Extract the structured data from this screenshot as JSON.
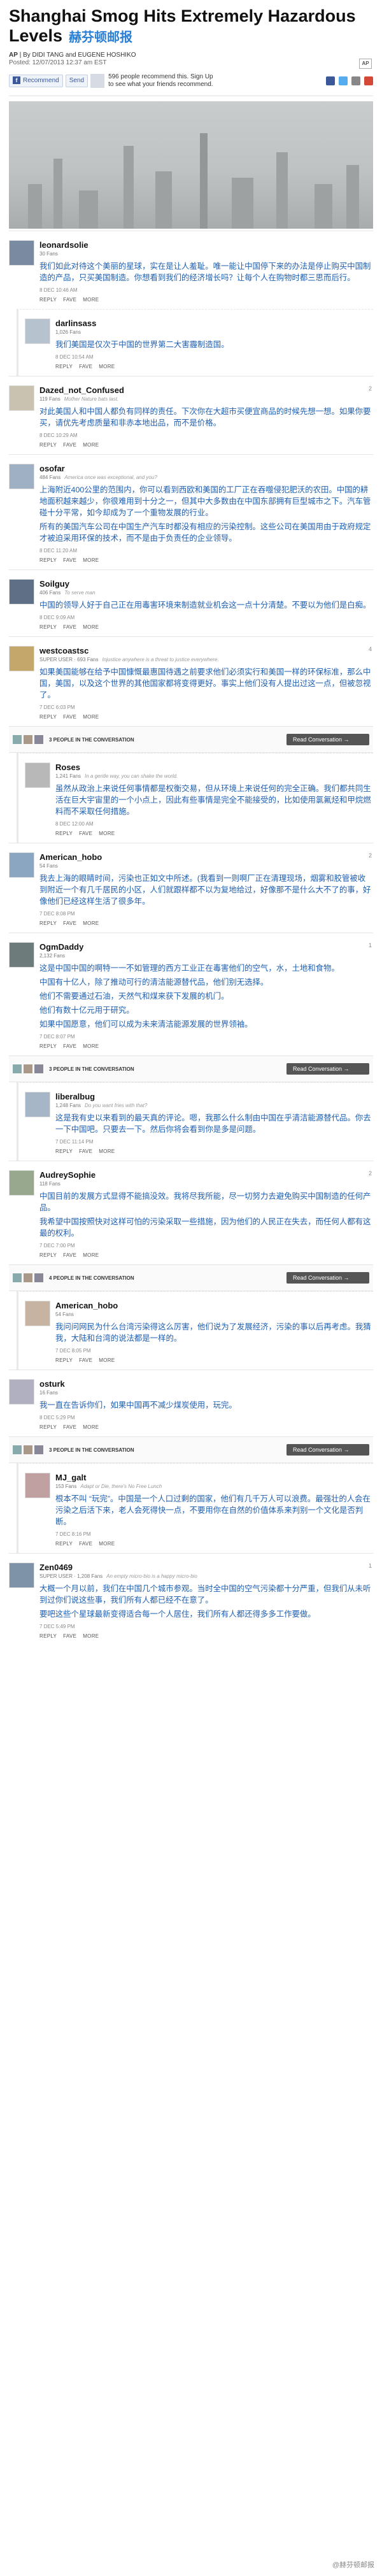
{
  "article": {
    "title": "Shanghai Smog Hits Extremely Hazardous Levels",
    "title_zh": "赫芬顿邮报",
    "byline_prefix": "AP",
    "byline": "| By DIDI TANG and EUGENE HOSHIKO",
    "posted": "Posted: 12/07/2013 12:37 am EST",
    "source_logo": "AP"
  },
  "social": {
    "recommend_label": "Recommend",
    "send_label": "Send",
    "recommend_text": "596 people recommend this. Sign Up to see what your friends recommend."
  },
  "comments": [
    {
      "user": "leonardsolie",
      "meta": "30 Fans",
      "tag": "",
      "text": [
        "我们如此对待这个美丽的星球，实在是让人羞耻。唯一能让中国停下来的办法是停止购买中国制造的产品，只买美国制造。你想看到我们的经济增长吗？让每个人在购物时都三思而后行。"
      ],
      "date": "8 DEC 10:46 AM",
      "actions": [
        "REPLY",
        "FAVE",
        "MORE"
      ],
      "child": false,
      "corner": ""
    },
    {
      "user": "darlinsass",
      "meta": "1,026 Fans",
      "tag": "",
      "text": [
        "我们美国是仅次于中国的世界第二大害霾制造国。"
      ],
      "date": "8 DEC 10:54 AM",
      "actions": [
        "REPLY",
        "FAVE",
        "MORE"
      ],
      "child": true,
      "corner": ""
    },
    {
      "user": "Dazed_not_Confused",
      "meta": "119 Fans",
      "tag": "Mother Nature bats last.",
      "text": [
        "对此美国人和中国人都负有同样的责任。下次你在大超市买便宜商品的时候先想一想。如果你要买，请优先考虑质量和非赤本地出品，而不是价格。"
      ],
      "date": "8 DEC 10:29 AM",
      "actions": [
        "REPLY",
        "FAVE",
        "MORE"
      ],
      "child": false,
      "corner": "2"
    },
    {
      "user": "osofar",
      "meta": "484 Fans",
      "tag": "America once was exceptional, and you?",
      "text": [
        "上海附近400公里的范围内，你可以看到西欧和美国的工厂正在吞噬侵犯肥沃的农田。中国的耕地面积越来越少，你很难用到十分之一，但其中大多数由在中国东部拥有巨型城市之下。汽车管碰十分平常，如今却成为了一个重物发展的行业。",
        "所有的美国汽车公司在中国生产汽车时都没有相应的污染控制。这些公司在美国用由于政府规定才被迫采用环保的技术，而不是由于负责任的企业领导。"
      ],
      "date": "8 DEC 11:20 AM",
      "actions": [
        "REPLY",
        "FAVE",
        "MORE"
      ],
      "child": false,
      "corner": ""
    },
    {
      "user": "Soilguy",
      "meta": "406 Fans",
      "tag": "To serve man",
      "text": [
        "中国的领导人好于自己正在用毒害环境来制造就业机会这一点十分清楚。不要以为他们是白痴。"
      ],
      "date": "8 DEC 9:09 AM",
      "actions": [
        "REPLY",
        "FAVE",
        "MORE"
      ],
      "child": false,
      "corner": ""
    },
    {
      "user": "westcoastsc",
      "meta": "SUPER USER · 693 Fans",
      "tag": "Injustice anywhere is a threat to justice everywhere.",
      "text": [
        "如果美国能够在给予中国慷慨最惠国待遇之前要求他们必须实行和美国一样的环保标准，那么中国，美国，以及这个世界的其他国家都将变得更好。事实上他们没有人提出过这一点，但被忽视了。"
      ],
      "date": "7 DEC 6:03 PM",
      "actions": [
        "REPLY",
        "FAVE",
        "MORE"
      ],
      "child": false,
      "corner": "4"
    },
    {
      "user": "Roses",
      "meta": "1,241 Fans",
      "tag": "In a gentle way, you can shake the world.",
      "text": [
        "虽然从政治上来说任何事情都是权衡交易，但从环境上来说任何的完全正确。我们都共同生活在巨大宇宙里的一个小点上，因此有些事情是完全不能接受的，比如使用氯氟烃和甲烷燃料而不采取任何措施。"
      ],
      "date": "8 DEC 12:00 AM",
      "actions": [
        "REPLY",
        "FAVE",
        "MORE"
      ],
      "child": true,
      "corner": ""
    },
    {
      "user": "American_hobo",
      "meta": "54 Fans",
      "tag": "",
      "text": [
        "我去上海的眼睛时间，污染也正如文中所述。(我看到一则啊厂正在清理现场，烟雾和胶管被收到附近一个有几千居民的小区，人们就跟样都不以为复地给过，好像那不是什么大不了的事，好像他们已经这样生活了很多年。"
      ],
      "date": "7 DEC 8:08 PM",
      "actions": [
        "REPLY",
        "FAVE",
        "MORE"
      ],
      "child": false,
      "corner": "2"
    },
    {
      "user": "OgmDaddy",
      "meta": "2,132 Fans",
      "tag": "",
      "text": [
        "这是中国中国的啊特一一不如管理的西方工业正在毒害他们的空气，水，土地和食物。",
        "中国有十亿人，除了推动可行的清洁能源替代品，他们别无选择。",
        "他们不需要通过石油，天然气和煤来获下发展的机门。",
        "他们有数十亿元用于研究。",
        "如果中国愿意，他们可以成为未来清洁能源发展的世界领袖。"
      ],
      "date": "7 DEC 8:07 PM",
      "actions": [
        "REPLY",
        "FAVE",
        "MORE"
      ],
      "child": false,
      "corner": "1"
    },
    {
      "user": "liberalbug",
      "meta": "1,248 Fans",
      "tag": "Do you want fries with that?",
      "text": [
        "这是我有史以来看到的最天真的评论。嗯，我那么什么制由中国在乎清洁能源替代品。你去一下中国吧。只要去一下。然后你将会看到你是多是问题。"
      ],
      "date": "7 DEC 11:14 PM",
      "actions": [
        "REPLY",
        "FAVE",
        "MORE"
      ],
      "child": true,
      "corner": ""
    },
    {
      "user": "AudreySophie",
      "meta": "118 Fans",
      "tag": "",
      "text": [
        "中国目前的发展方式显得不能搞没效。我将尽我所能，尽一切努力去避免购买中国制造的任何产品。",
        "我希望中国按照快对这样可怕的污染采取一些措施，因为他们的人民正在失去，而任何人都有这最的权利。"
      ],
      "date": "7 DEC 7:00 PM",
      "actions": [
        "REPLY",
        "FAVE",
        "MORE"
      ],
      "child": false,
      "corner": "2"
    },
    {
      "user": "American_hobo",
      "meta": "54 Fans",
      "tag": "",
      "text": [
        "我问问网民为什么台湾污染得这么厉害，他们说为了发展经济，污染的事以后再考虑。我猜我，大陆和台湾的说法都是一样的。"
      ],
      "date": "7 DEC 8:05 PM",
      "actions": [
        "REPLY",
        "FAVE",
        "MORE"
      ],
      "child": true,
      "corner": ""
    },
    {
      "user": "osturk",
      "meta": "16 Fans",
      "tag": "",
      "text": [
        "我一直在告诉你们，如果中国再不减少煤炭使用，玩完。"
      ],
      "date": "8 DEC 5:29 PM",
      "actions": [
        "REPLY",
        "FAVE",
        "MORE"
      ],
      "child": false,
      "corner": ""
    },
    {
      "user": "MJ_galt",
      "meta": "153 Fans",
      "tag": "Adapt or Die, there's No Free Lunch",
      "text": [
        "根本不叫 “玩完”。中国是一个人口过剩的国家，他们有几千万人可以浪费。最强壮的人会在污染之后活下来，老人会死得快一点，不要用你在自然的价值体系来判别一个文化是否判断。"
      ],
      "date": "7 DEC 8:16 PM",
      "actions": [
        "REPLY",
        "FAVE",
        "MORE"
      ],
      "child": true,
      "corner": ""
    },
    {
      "user": "Zen0469",
      "meta": "SUPER USER · 1,208 Fans",
      "tag": "An empty micro-bio is a happy micro-bio",
      "text": [
        "大概一个月以前，我们在中国几个城市参观。当时全中国的空气污染都十分严重，但我们从未听到过你们说这些事，我们所有人都已经不在意了。",
        "要吧这些个星球最新变得适合每一个人居住，我们所有人都还得多多工作要做。"
      ],
      "date": "7 DEC 5:49 PM",
      "actions": [
        "REPLY",
        "FAVE",
        "MORE"
      ],
      "child": false,
      "corner": "1"
    }
  ],
  "conversations": [
    {
      "after": 6,
      "count_label": "3 PEOPLE IN THE CONVERSATION",
      "button": "Read Conversation →"
    },
    {
      "after": 9,
      "count_label": "3 PEOPLE IN THE CONVERSATION",
      "button": "Read Conversation →"
    },
    {
      "after": 11,
      "count_label": "4 PEOPLE IN THE CONVERSATION",
      "button": "Read Conversation →"
    },
    {
      "after": 13,
      "count_label": "3 PEOPLE IN THE CONVERSATION",
      "button": "Read Conversation →"
    }
  ],
  "watermark": "@赫芬顿邮报"
}
